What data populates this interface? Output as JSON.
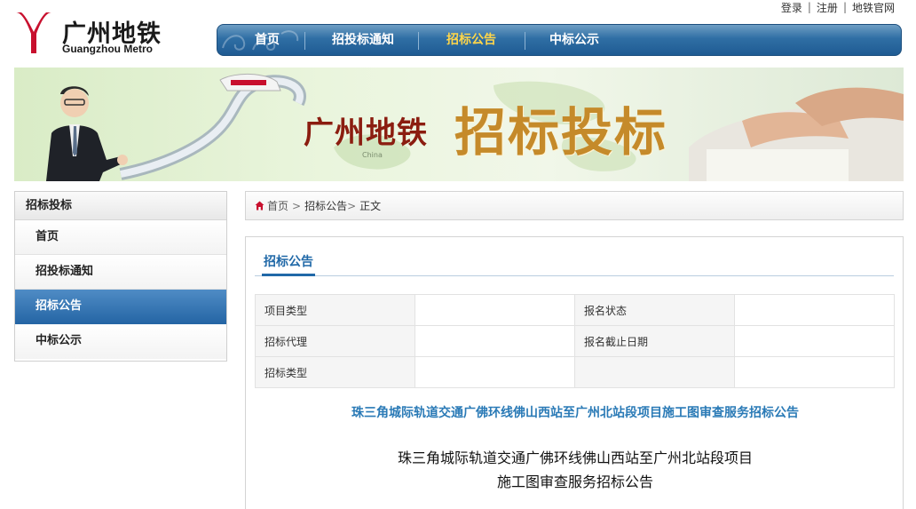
{
  "top_links": [
    "登录",
    "注册",
    "地铁官网"
  ],
  "logo": {
    "cn": "广州地铁",
    "en": "Guangzhou Metro"
  },
  "nav": {
    "items": [
      "首页",
      "招投标通知",
      "招标公告",
      "中标公示"
    ],
    "active": "招标公告"
  },
  "banner": {
    "title_small": "广州地铁",
    "title_big": "招标投标",
    "map_label": "China"
  },
  "sidebar": {
    "heading": "招标投标",
    "items": [
      "首页",
      "招投标通知",
      "招标公告",
      "中标公示"
    ],
    "active": "招标公告"
  },
  "breadcrumb": {
    "home": "首页",
    "section": "招标公告",
    "current": "正文"
  },
  "content": {
    "tab": "招标公告",
    "info_rows": [
      {
        "label1": "项目类型",
        "value1": "",
        "label2": "报名状态",
        "value2": ""
      },
      {
        "label1": "招标代理",
        "value1": "",
        "label2": "报名截止日期",
        "value2": ""
      },
      {
        "label1": "招标类型",
        "value1": "",
        "label2": "",
        "value2": ""
      }
    ],
    "link_title": "珠三角城际轨道交通广佛环线佛山西站至广州北站段项目施工图审查服务招标公告",
    "body_title_line1": "珠三角城际轨道交通广佛环线佛山西站至广州北站段项目",
    "body_title_line2": "施工图审查服务招标公告"
  },
  "colors": {
    "nav_blue": "#2f6ea4",
    "active_nav_text": "#ffd64a",
    "sidebar_active": "#2566a5",
    "link_blue": "#2a7ab6",
    "logo_red": "#c8102e"
  }
}
